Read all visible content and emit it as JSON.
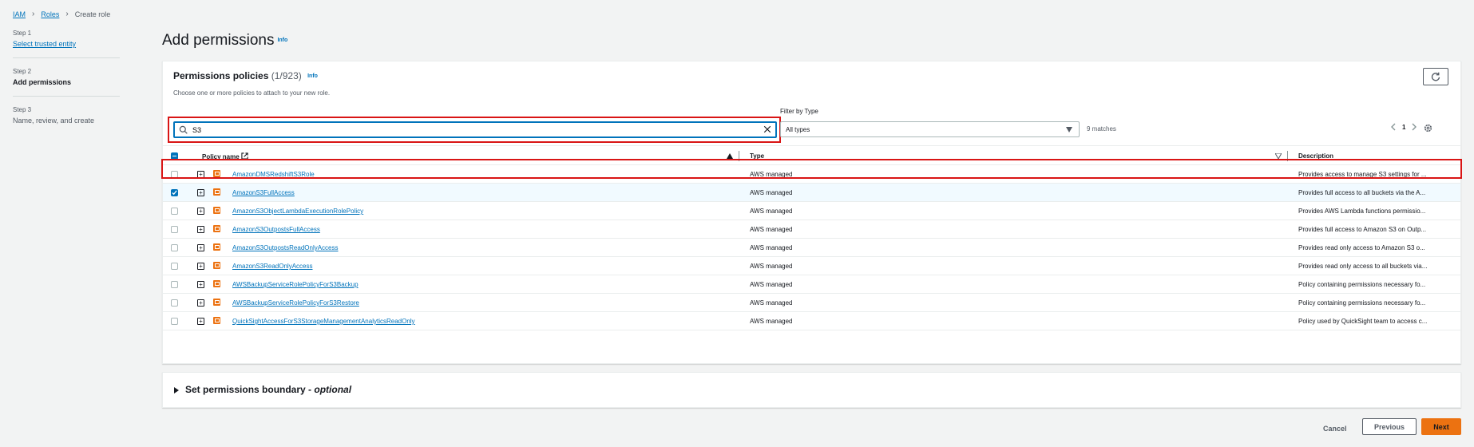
{
  "breadcrumb": {
    "items": [
      "IAM",
      "Roles"
    ],
    "current": "Create role"
  },
  "steps": [
    {
      "num": "Step 1",
      "title": "Select trusted entity"
    },
    {
      "num": "Step 2",
      "title": "Add permissions"
    },
    {
      "num": "Step 3",
      "title": "Name, review, and create"
    }
  ],
  "page": {
    "title": "Add permissions",
    "info": "Info"
  },
  "panel": {
    "title": "Permissions policies",
    "count": "(1/923)",
    "info": "Info",
    "description": "Choose one or more policies to attach to your new role.",
    "refresh_icon": "refresh-icon"
  },
  "search": {
    "value": "S3",
    "placeholder": ""
  },
  "filter": {
    "label": "Filter by Type",
    "selected": "All types",
    "matches": "9 matches"
  },
  "pager": {
    "page": "1"
  },
  "table": {
    "headers": {
      "policy_name": "Policy name",
      "type": "Type",
      "description": "Description"
    },
    "rows": [
      {
        "name": "AmazonDMSRedshiftS3Role",
        "type": "AWS managed",
        "description": "Provides access to manage S3 settings for ...",
        "checked": false
      },
      {
        "name": "AmazonS3FullAccess",
        "type": "AWS managed",
        "description": "Provides full access to all buckets via the A...",
        "checked": true
      },
      {
        "name": "AmazonS3ObjectLambdaExecutionRolePolicy",
        "type": "AWS managed",
        "description": "Provides AWS Lambda functions permissio...",
        "checked": false
      },
      {
        "name": "AmazonS3OutpostsFullAccess",
        "type": "AWS managed",
        "description": "Provides full access to Amazon S3 on Outp...",
        "checked": false
      },
      {
        "name": "AmazonS3OutpostsReadOnlyAccess",
        "type": "AWS managed",
        "description": "Provides read only access to Amazon S3 o...",
        "checked": false
      },
      {
        "name": "AmazonS3ReadOnlyAccess",
        "type": "AWS managed",
        "description": "Provides read only access to all buckets via...",
        "checked": false
      },
      {
        "name": "AWSBackupServiceRolePolicyForS3Backup",
        "type": "AWS managed",
        "description": "Policy containing permissions necessary fo...",
        "checked": false
      },
      {
        "name": "AWSBackupServiceRolePolicyForS3Restore",
        "type": "AWS managed",
        "description": "Policy containing permissions necessary fo...",
        "checked": false
      },
      {
        "name": "QuickSightAccessForS3StorageManagementAnalyticsReadOnly",
        "type": "AWS managed",
        "description": "Policy used by QuickSight team to access c...",
        "checked": false
      }
    ]
  },
  "boundary": {
    "title": "Set permissions boundary - ",
    "optional": "optional"
  },
  "footer": {
    "cancel": "Cancel",
    "previous": "Previous",
    "next": "Next"
  },
  "colors": {
    "accent": "#0073bb",
    "primary_button": "#ec7211",
    "highlight": "#d91515"
  }
}
